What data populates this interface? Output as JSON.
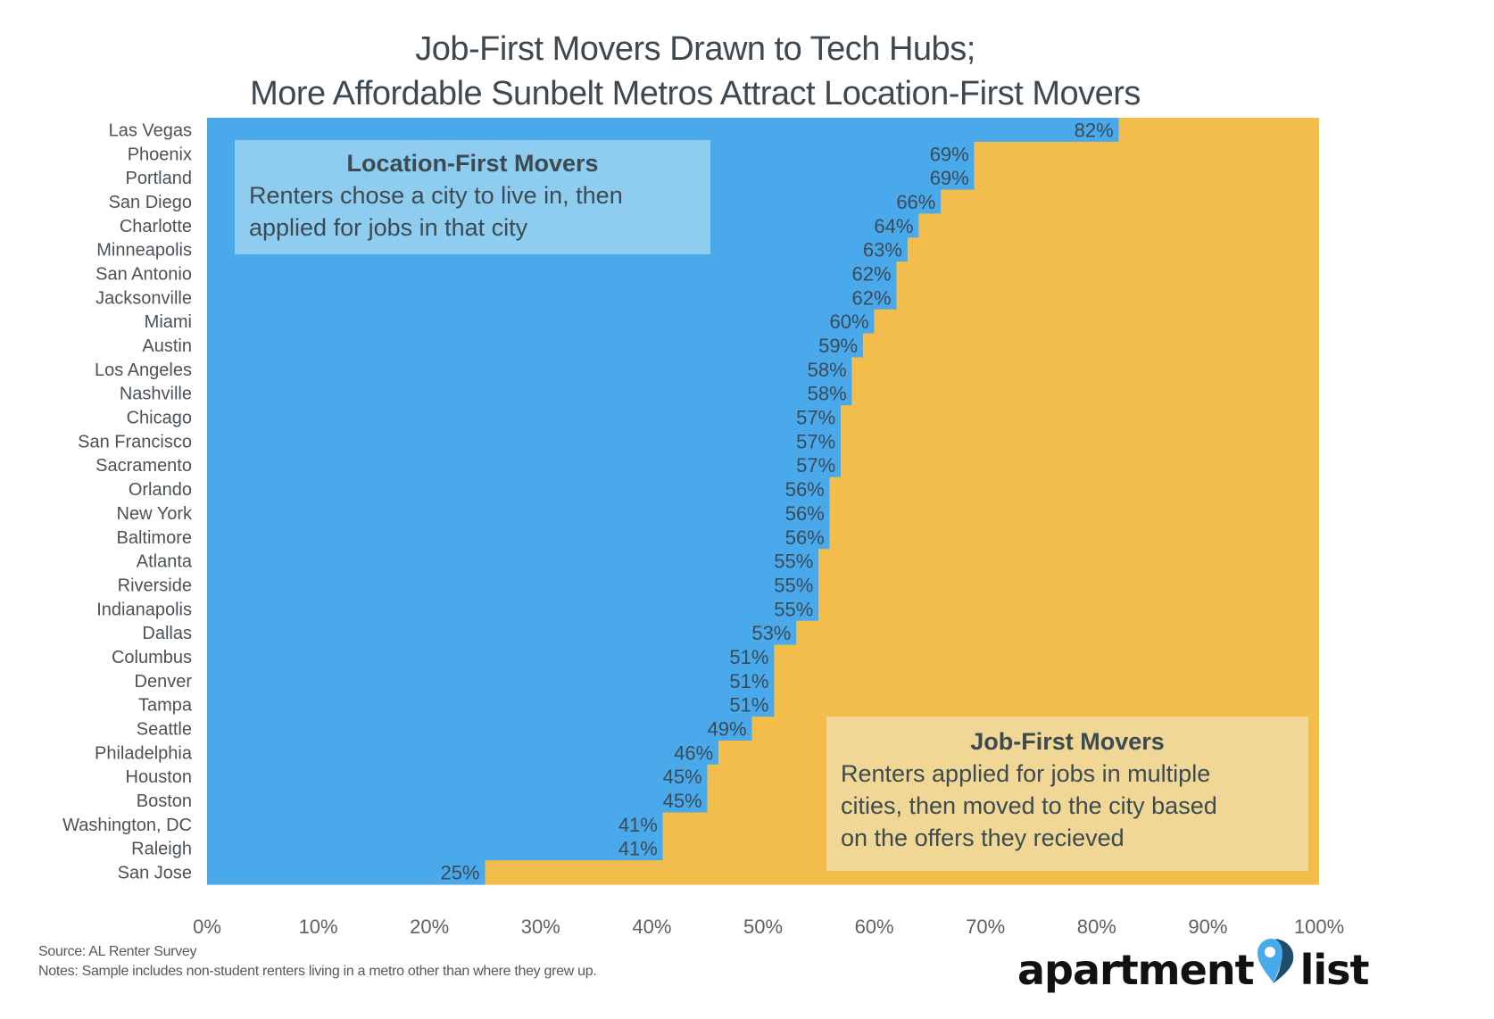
{
  "chart_data": {
    "type": "bar",
    "orientation": "horizontal",
    "stacked": true,
    "title": "Job-First Movers Drawn to Tech Hubs; More Affordable Sunbelt Metros Attract Location-First Movers",
    "title_lines": [
      "Job-First Movers Drawn to Tech Hubs;",
      "More Affordable Sunbelt Metros Attract Location-First Movers"
    ],
    "xlabel": "",
    "ylabel": "",
    "xlim": [
      0,
      100
    ],
    "grid": false,
    "x_ticks": [
      "0%",
      "10%",
      "20%",
      "30%",
      "40%",
      "50%",
      "60%",
      "70%",
      "80%",
      "90%",
      "100%"
    ],
    "categories": [
      "Las Vegas",
      "Phoenix",
      "Portland",
      "San Diego",
      "Charlotte",
      "Minneapolis",
      "San Antonio",
      "Jacksonville",
      "Miami",
      "Austin",
      "Los Angeles",
      "Nashville",
      "Chicago",
      "San Francisco",
      "Sacramento",
      "Orlando",
      "New York",
      "Baltimore",
      "Atlanta",
      "Riverside",
      "Indianapolis",
      "Dallas",
      "Columbus",
      "Denver",
      "Tampa",
      "Seattle",
      "Philadelphia",
      "Houston",
      "Boston",
      "Washington, DC",
      "Raleigh",
      "San Jose"
    ],
    "series": [
      {
        "name": "Location-First Movers",
        "color": "#4aa9eb",
        "values": [
          82,
          69,
          69,
          66,
          64,
          63,
          62,
          62,
          60,
          59,
          58,
          58,
          57,
          57,
          57,
          56,
          56,
          56,
          55,
          55,
          55,
          53,
          51,
          51,
          51,
          49,
          46,
          45,
          45,
          41,
          41,
          25
        ],
        "labels": [
          "82%",
          "69%",
          "69%",
          "66%",
          "64%",
          "63%",
          "62%",
          "62%",
          "60%",
          "59%",
          "58%",
          "58%",
          "57%",
          "57%",
          "57%",
          "56%",
          "56%",
          "56%",
          "55%",
          "55%",
          "55%",
          "53%",
          "51%",
          "51%",
          "51%",
          "49%",
          "46%",
          "45%",
          "45%",
          "41%",
          "41%",
          "25%"
        ]
      },
      {
        "name": "Job-First Movers",
        "color": "#f2bd4a",
        "values": [
          18,
          31,
          31,
          34,
          36,
          37,
          38,
          38,
          40,
          41,
          42,
          42,
          43,
          43,
          43,
          44,
          44,
          44,
          45,
          45,
          45,
          47,
          49,
          49,
          49,
          51,
          54,
          55,
          55,
          59,
          59,
          75
        ]
      }
    ],
    "legend": "annotation boxes (top-left and bottom-right)"
  },
  "annotations": {
    "location_first": {
      "heading": "Location-First Movers",
      "lines": [
        "Renters chose a city to live in, then",
        "applied for jobs in that city"
      ],
      "color": "#8ecdf0"
    },
    "job_first": {
      "heading": "Job-First Movers",
      "lines": [
        "Renters applied for jobs in multiple",
        "cities, then moved to the city based",
        "on the offers they recieved"
      ],
      "color": "#f1d795"
    }
  },
  "footer": {
    "source": "Source: AL Renter Survey",
    "notes": "Notes: Sample includes non-student renters living in a metro other than where they grew up."
  },
  "logo": {
    "left_word": "apartment",
    "right_word": "list",
    "icon": "map-pin-icon"
  }
}
